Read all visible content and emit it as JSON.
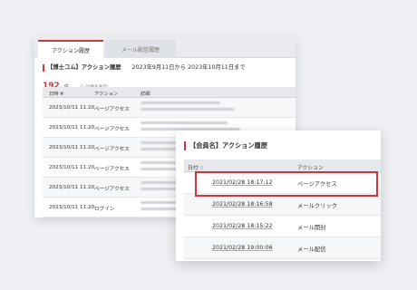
{
  "back": {
    "tabs": [
      "アクション履歴",
      "メール配信履歴"
    ],
    "heading": "【博士コム】アクション履歴",
    "period": "2023年9月11日から 2023年10月11日まで",
    "count": "192",
    "count_unit": "件",
    "count_note": "（1-20件を表示）",
    "columns": [
      "日時",
      "アクション",
      "詳細"
    ],
    "rows": [
      {
        "date": "2023/10/11 11:20",
        "action": "ページアクセス"
      },
      {
        "date": "2023/10/11 11:20",
        "action": "ページアクセス"
      },
      {
        "date": "2023/10/11 11:20",
        "action": "ページアクセス"
      },
      {
        "date": "2023/10/11 11:20",
        "action": "ページアクセス"
      },
      {
        "date": "2023/10/11 11:20",
        "action": "ページアクセス"
      },
      {
        "date": "2023/10/11 11:20",
        "action": "ログイン"
      }
    ]
  },
  "front": {
    "heading": "【会員名】アクション履歴",
    "columns": [
      "日付",
      "アクション"
    ],
    "rows": [
      {
        "date": "2021/02/28 18:17:12",
        "action": "ページアクセス"
      },
      {
        "date": "2021/02/28 18:16:58",
        "action": "メールクリック"
      },
      {
        "date": "2021/02/28 18:15:22",
        "action": "メール開封"
      },
      {
        "date": "2021/02/28 19:00:06",
        "action": "メール配信"
      }
    ]
  },
  "colors": {
    "accent": "#d5323d"
  }
}
